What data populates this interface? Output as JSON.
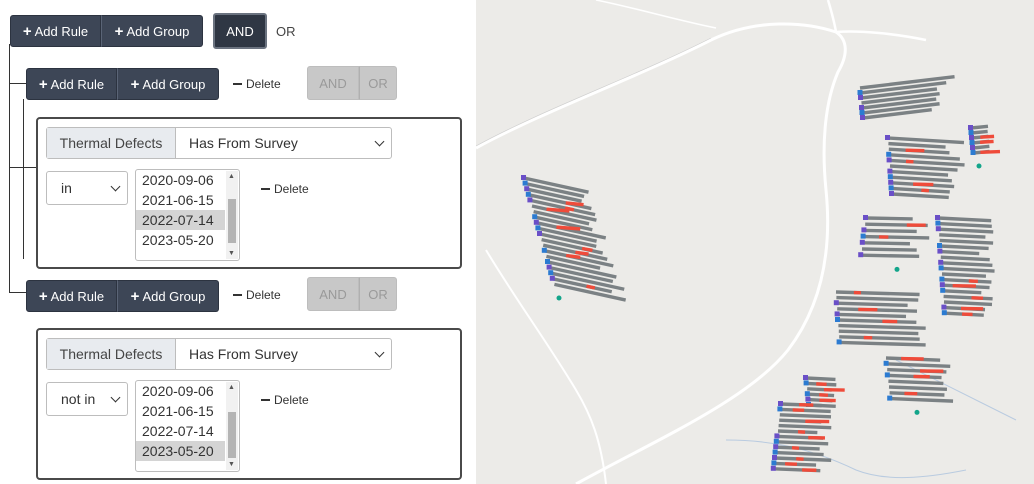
{
  "toolbar": {
    "add_rule": "Add Rule",
    "add_group": "Add Group",
    "and": "AND",
    "or": "OR",
    "delete": "Delete"
  },
  "rules": [
    {
      "field_label": "Thermal Defects",
      "field_value": "Has From Survey",
      "operator": "in",
      "dates": [
        "2020-09-06",
        "2021-06-15",
        "2022-07-14",
        "2023-05-20"
      ],
      "selected_index": 2
    },
    {
      "field_label": "Thermal Defects",
      "field_value": "Has From Survey",
      "operator": "not in",
      "dates": [
        "2020-09-06",
        "2021-06-15",
        "2022-07-14",
        "2023-05-20"
      ],
      "selected_index": 3
    }
  ],
  "map": {
    "panel_color": "#7b8184",
    "defect_color": "#ef4b3a",
    "marker_colors": [
      "#6a4fc7",
      "#2c7bd1",
      "#13a58a"
    ]
  }
}
